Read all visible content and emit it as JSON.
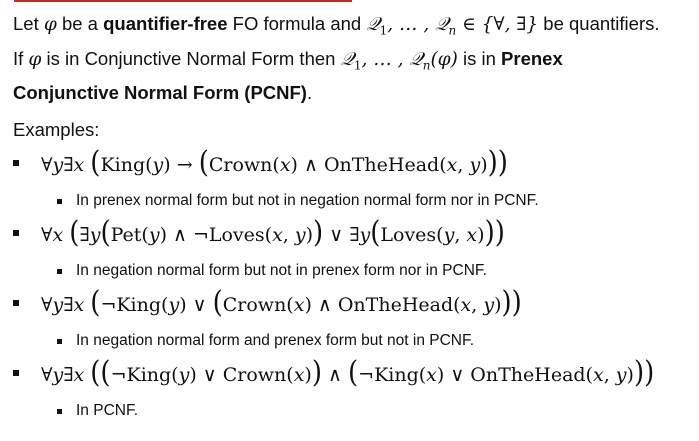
{
  "intro": {
    "t1": "Let ",
    "phi": "φ",
    "t2": " be a ",
    "bold1": "quantifier-free",
    "t3": " FO formula and ",
    "q_list": "𝒬",
    "t4": " be quantifiers.",
    "t5": "If ",
    "t6": " is in Conjunctive Normal Form then ",
    "t7": " is in ",
    "bold2": "Prenex Conjunctive Normal Form (PCNF)",
    "t8": "."
  },
  "examples_heading": "Examples:",
  "examples": [
    {
      "formula": "∀y∃x (King(y) → (Crown(x) ∧ OnTheHead(x, y)))",
      "note": "In prenex normal form but not in negation normal form nor in PCNF."
    },
    {
      "formula": "∀x (∃y(Pet(y) ∧ ¬Loves(x, y)) ∨ ∃y(Loves(y, x)))",
      "note": "In negation normal form but not in prenex form nor in PCNF."
    },
    {
      "formula": "∀y∃x (¬King(y) ∨ (Crown(x) ∧ OnTheHead(x, y)))",
      "note": "In negation normal form and prenex form but not in PCNF."
    },
    {
      "formula": "∀y∃x ((¬King(y) ∨ Crown(x)) ∧ (¬King(x) ∨ OnTheHead(x, y)))",
      "note": "In PCNF."
    }
  ]
}
